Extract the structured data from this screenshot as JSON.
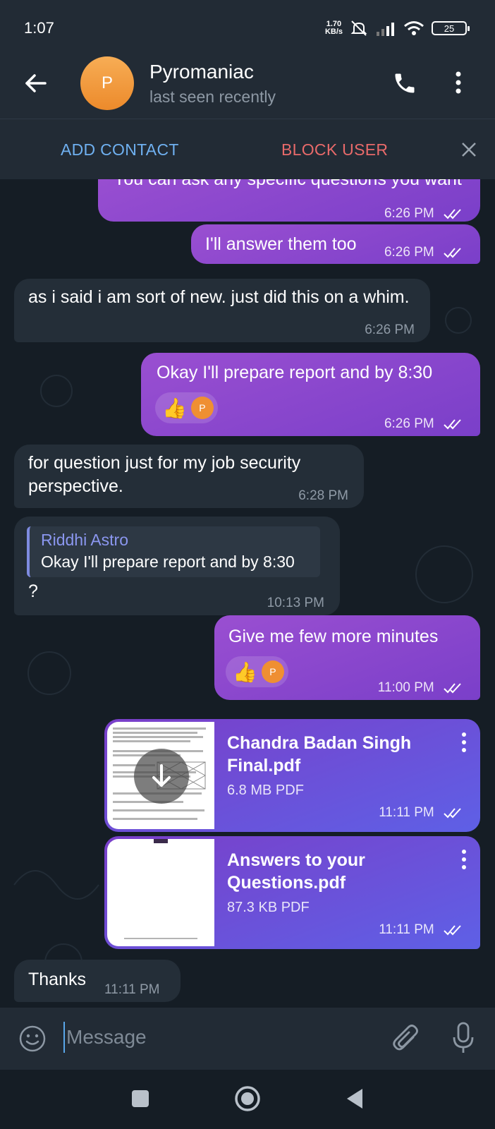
{
  "status_bar": {
    "time": "1:07",
    "net_speed_value": "1.70",
    "net_speed_unit": "KB/s",
    "battery": "25"
  },
  "header": {
    "avatar_letter": "P",
    "contact_name": "Pyromaniac",
    "last_seen": "last seen recently"
  },
  "action_bar": {
    "add_contact": "ADD CONTACT",
    "block_user": "BLOCK USER"
  },
  "messages": [
    {
      "text": "You can ask any specific questions you want",
      "time": "6:26 PM"
    },
    {
      "text": "I'll answer them too",
      "time": "6:26 PM"
    },
    {
      "text": "as i said i am sort of new. just did this on a whim.",
      "time": "6:26 PM"
    },
    {
      "text": "Okay I'll prepare report and by 8:30",
      "time": "6:26 PM",
      "reaction_avatar": "P"
    },
    {
      "text": "for question just for my job security perspective.",
      "time": "6:28 PM"
    },
    {
      "reply_name": "Riddhi Astro",
      "reply_text": "Okay I'll prepare report and by 8:30",
      "text": "?",
      "time": "10:13 PM"
    },
    {
      "text": "Give me few more minutes",
      "time": "11:00 PM",
      "reaction_avatar": "P"
    },
    {
      "file_name": "Chandra Badan Singh Final.pdf",
      "file_size": "6.8 MB PDF",
      "time": "11:11 PM"
    },
    {
      "file_name": "Answers to your Questions.pdf",
      "file_size": "87.3 KB PDF",
      "time": "11:11 PM"
    },
    {
      "text": "Thanks",
      "time": "11:11 PM"
    }
  ],
  "composer": {
    "placeholder": "Message"
  },
  "colors": {
    "outgoing_bubble": "#8a47cd",
    "incoming_bubble": "#242e38",
    "add_contact": "#6fb0f0",
    "block_user": "#e86a6a",
    "reply_accent": "#7e8be0"
  }
}
